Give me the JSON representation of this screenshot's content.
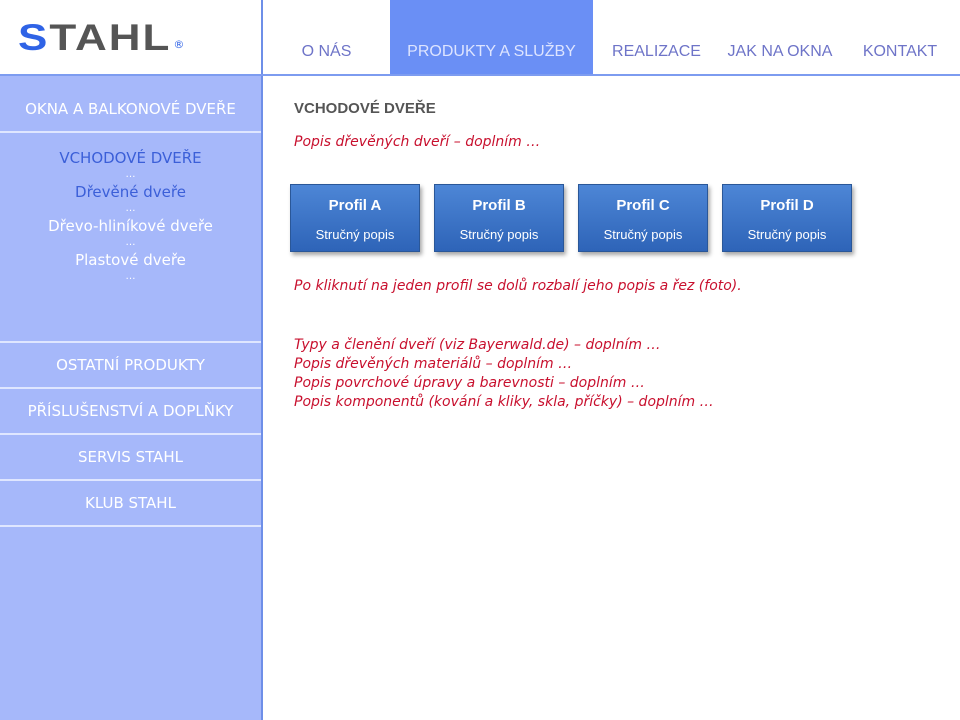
{
  "logo": {
    "text": "STAHL",
    "mark": "®",
    "colors": {
      "s": "#2f63e6",
      "rest": "#555555"
    }
  },
  "nav": [
    {
      "label": "O NÁS",
      "active": false
    },
    {
      "label": "PRODUKTY A SLUŽBY",
      "active": true
    },
    {
      "label": "REALIZACE",
      "active": false
    },
    {
      "label": "JAK NA OKNA",
      "active": false
    },
    {
      "label": "KONTAKT",
      "active": false
    }
  ],
  "sidebar": {
    "top": "OKNA A BALKONOVÉ DVEŘE",
    "current": "VCHODOVÉ DVEŘE",
    "sub": [
      {
        "label": "Dřevěné dveře"
      },
      {
        "label": "Dřevo-hliníkové dveře"
      },
      {
        "label": "Plastové dveře"
      }
    ],
    "ellipsis": "…",
    "items": [
      {
        "label": "OSTATNÍ PRODUKTY"
      },
      {
        "label": "PŘÍSLUŠENSTVÍ A DOPLŇKY"
      },
      {
        "label": "SERVIS STAHL"
      },
      {
        "label": "KLUB STAHL"
      }
    ]
  },
  "main": {
    "title": "VCHODOVÉ DVEŘE",
    "intro": "Popis dřevěných dveří – doplním …",
    "profiles": [
      {
        "name": "Profil A",
        "desc": "Stručný popis"
      },
      {
        "name": "Profil B",
        "desc": "Stručný popis"
      },
      {
        "name": "Profil C",
        "desc": "Stručný popis"
      },
      {
        "name": "Profil D",
        "desc": "Stručný popis"
      }
    ],
    "note": "Po kliknutí na jeden profil se dolů rozbalí jeho popis a řez (foto).",
    "list": [
      "Typy a členění dveří (viz Bayerwald.de) – doplním …",
      "Popis dřevěných materiálů – doplním …",
      "Popis povrchové úpravy a barevnosti – doplním …",
      "Popis komponentů (kování a kliky, skla, příčky) – doplním …"
    ]
  }
}
